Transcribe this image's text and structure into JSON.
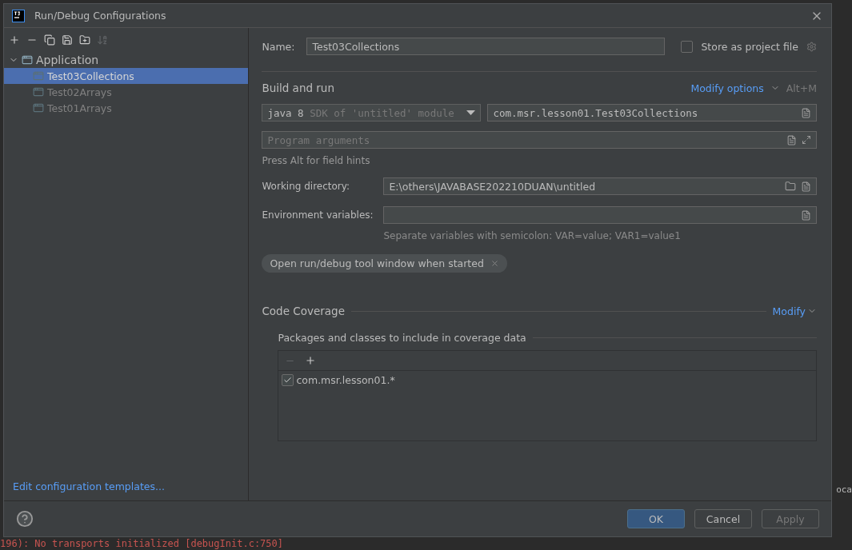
{
  "background": {
    "console_line": "196): No transports initialized [debugInit.c:750]",
    "side_text": "oca"
  },
  "window": {
    "title": "Run/Debug Configurations"
  },
  "toolbar": [
    {
      "kind": "add",
      "disabled": false
    },
    {
      "kind": "remove",
      "disabled": false
    },
    {
      "kind": "copy",
      "disabled": false
    },
    {
      "kind": "save",
      "disabled": false
    },
    {
      "kind": "folder",
      "disabled": false
    },
    {
      "kind": "sort",
      "disabled": true
    }
  ],
  "tree": [
    {
      "label": "Application",
      "expanded": true,
      "selected": false,
      "children": [
        {
          "label": "Test03Collections",
          "selected": true
        },
        {
          "label": "Test02Arrays",
          "selected": false
        },
        {
          "label": "Test01Arrays",
          "selected": false
        }
      ]
    }
  ],
  "edit_templates_link": "Edit configuration templates...",
  "name": {
    "label": "Name:",
    "value": "Test03Collections"
  },
  "store_checkbox": {
    "label": "Store as project file",
    "checked": false
  },
  "build_and_run": {
    "title": "Build and run",
    "modify_link": "Modify options",
    "shortcut": "Alt+M",
    "sdk": {
      "value": "java 8",
      "hint": "SDK of 'untitled' module"
    },
    "main_class": "com.msr.lesson01.Test03Collections",
    "program_args": {
      "placeholder": "Program arguments"
    },
    "hint": "Press Alt for field hints"
  },
  "working_directory": {
    "label": "Working directory:",
    "value": "E:\\others\\JAVABASE202210DUAN\\untitled"
  },
  "environment": {
    "label": "Environment variables:",
    "note": "Separate variables with semicolon: VAR=value; VAR1=value1"
  },
  "option_tags": [
    {
      "label": "Open run/debug tool window when started"
    }
  ],
  "coverage": {
    "title": "Code Coverage",
    "modify_link": "Modify",
    "subtitle": "Packages and classes to include in coverage data",
    "remove_disabled": true,
    "entries": [
      {
        "pattern": "com.msr.lesson01.*",
        "checked": true
      }
    ]
  },
  "buttons": [
    {
      "label": "OK",
      "kind": "primary",
      "disabled": false
    },
    {
      "label": "Cancel",
      "kind": "normal",
      "disabled": false
    },
    {
      "label": "Apply",
      "kind": "normal",
      "disabled": true
    }
  ]
}
